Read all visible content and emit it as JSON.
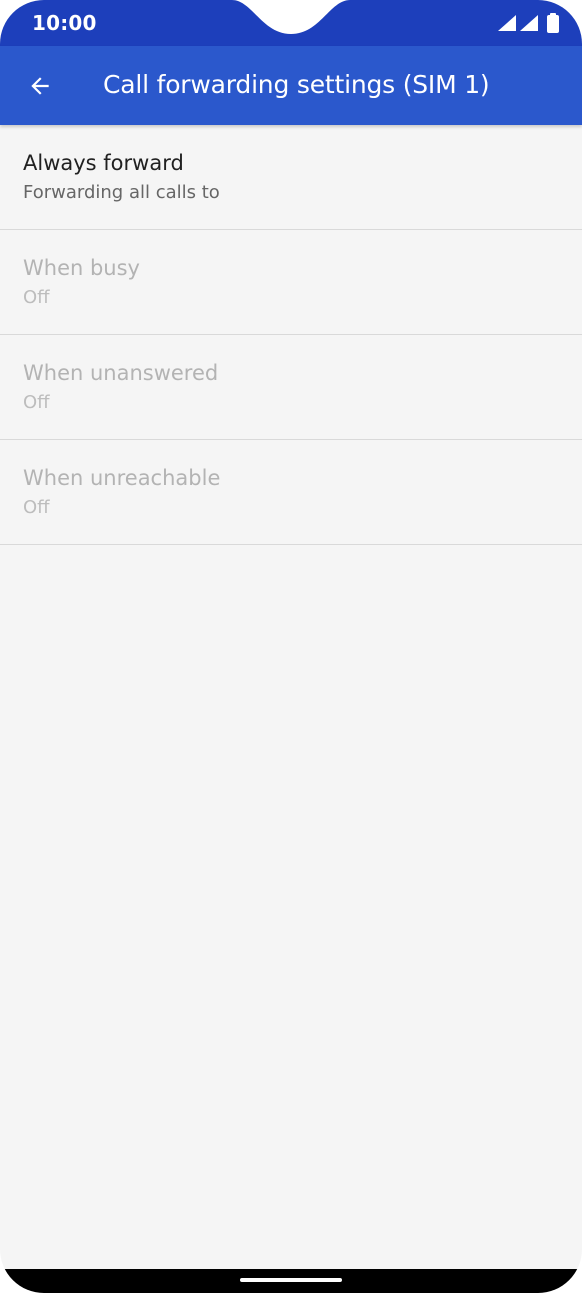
{
  "status_bar": {
    "time": "10:00",
    "icons": [
      "signal-icon",
      "signal-icon",
      "battery-icon"
    ]
  },
  "app_bar": {
    "title": "Call forwarding settings (SIM 1)",
    "back_icon": "arrow-back-icon"
  },
  "items": [
    {
      "title": "Always forward",
      "summary": "Forwarding all calls to",
      "enabled": true
    },
    {
      "title": "When busy",
      "summary": "Off",
      "enabled": false
    },
    {
      "title": "When unanswered",
      "summary": "Off",
      "enabled": false
    },
    {
      "title": "When unreachable",
      "summary": "Off",
      "enabled": false
    }
  ],
  "colors": {
    "status_bar": "#1d3fbb",
    "app_bar": "#2b58cc",
    "background": "#f5f5f5",
    "text_primary": "#212121",
    "text_disabled": "#b3b3b3"
  }
}
